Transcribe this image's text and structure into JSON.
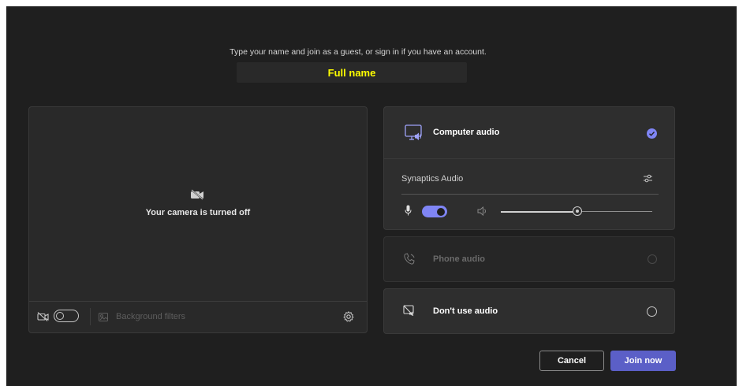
{
  "prompt_text": "Type your name and join as a guest, or sign in if you have an account.",
  "name_input": {
    "value": "",
    "placeholder": "Full name"
  },
  "camera": {
    "status_text": "Your camera is turned off",
    "background_filters_label": "Background filters"
  },
  "audio": {
    "computer_audio": {
      "label": "Computer audio",
      "device_name": "Synaptics Audio",
      "mic_on": true,
      "volume_percent": 50
    },
    "phone_audio": {
      "label": "Phone audio"
    },
    "no_audio": {
      "label": "Don't use audio"
    }
  },
  "buttons": {
    "cancel": "Cancel",
    "join": "Join now"
  },
  "colors": {
    "accent": "#7f85f5",
    "primary_button": "#5b5fc7",
    "background": "#1f1f1f",
    "name_text": "#ffff00"
  }
}
